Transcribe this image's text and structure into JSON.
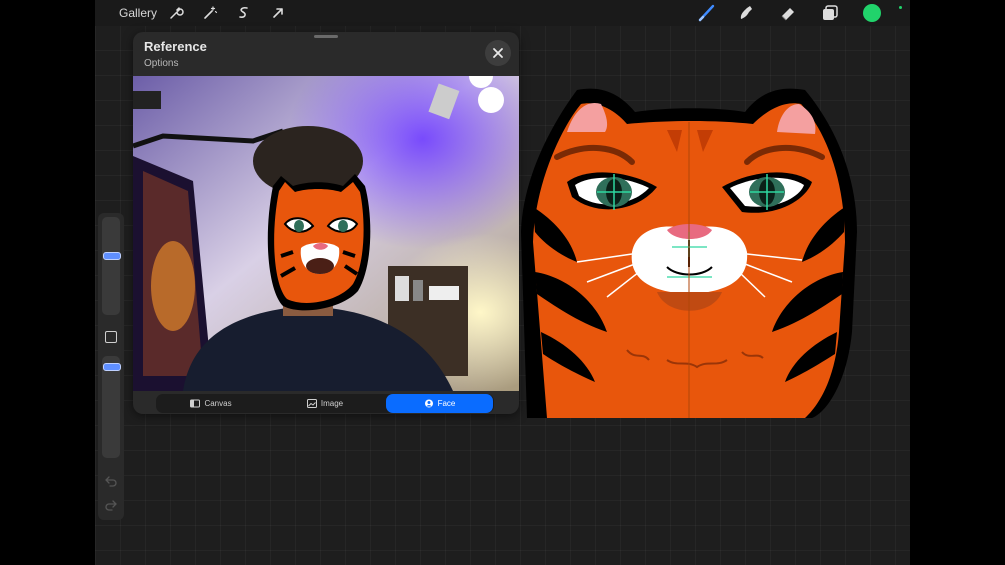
{
  "toolbar": {
    "gallery_label": "Gallery",
    "left_icons": [
      "wrench-icon",
      "magic-wand-icon",
      "selection-icon",
      "transform-arrow-icon"
    ],
    "right_icons": [
      "brush-icon",
      "smudge-icon",
      "eraser-icon",
      "layers-icon"
    ],
    "current_color": "#21d36b"
  },
  "reference": {
    "title": "Reference",
    "options_label": "Options",
    "close_icon": "close-icon",
    "segments": [
      {
        "label": "Canvas",
        "icon": "canvas-icon",
        "active": false
      },
      {
        "label": "Image",
        "icon": "image-icon",
        "active": false
      },
      {
        "label": "Face",
        "icon": "face-icon",
        "active": true
      }
    ]
  },
  "colors": {
    "accent": "#0a6cff",
    "tiger_orange": "#e8560c",
    "stripe": "#000000",
    "eye_green": "#2ed8a0"
  }
}
